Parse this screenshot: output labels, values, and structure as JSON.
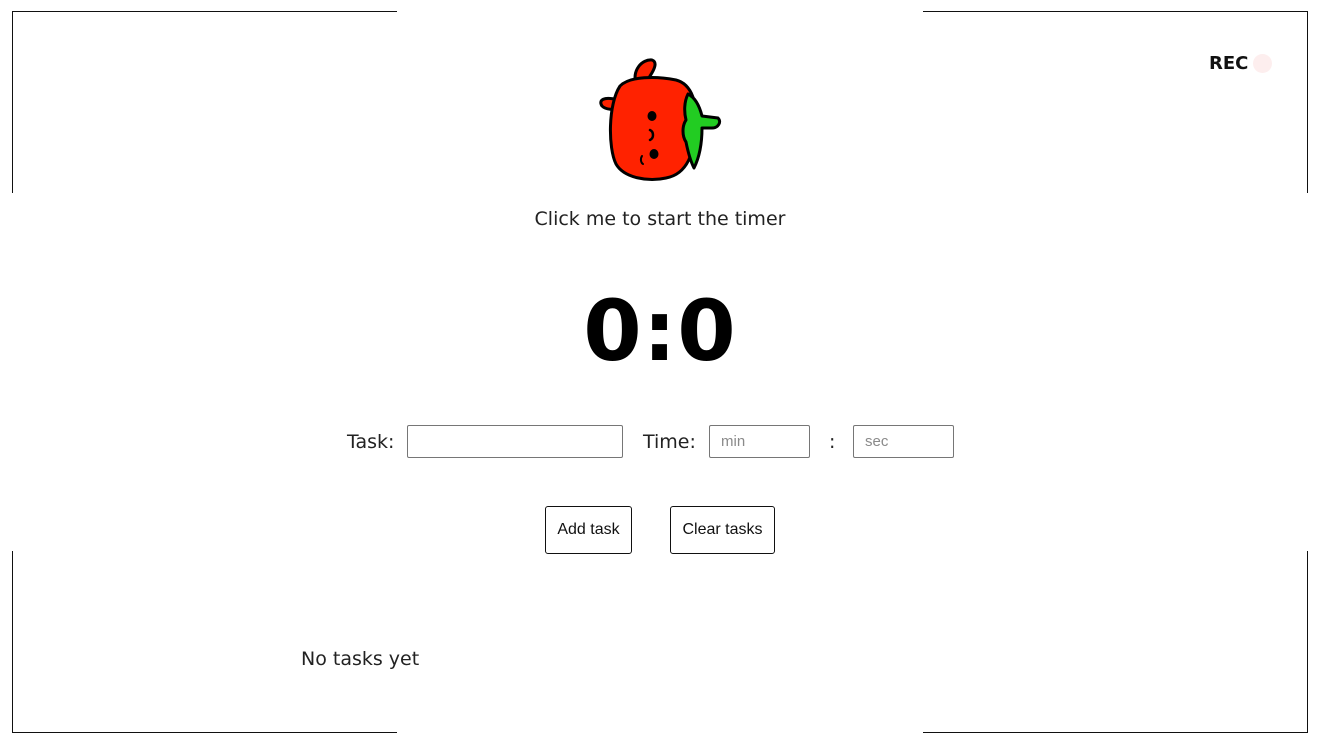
{
  "recording": {
    "label": "REC",
    "dot_color": "#fdeeee"
  },
  "tomato": {
    "icon": "tomato-icon",
    "body_color": "#ff2200",
    "leaf_color": "#22cc22"
  },
  "hint": "Click me to start the timer",
  "timer": {
    "display": "0:0"
  },
  "form": {
    "task_label": "Task:",
    "task_value": "",
    "task_placeholder": "",
    "time_label": "Time:",
    "minutes_value": "",
    "minutes_placeholder": "min",
    "separator": ":",
    "seconds_value": "",
    "seconds_placeholder": "sec"
  },
  "buttons": {
    "add": "Add task",
    "clear": "Clear tasks"
  },
  "tasks": {
    "empty_message": "No tasks yet",
    "items": []
  }
}
